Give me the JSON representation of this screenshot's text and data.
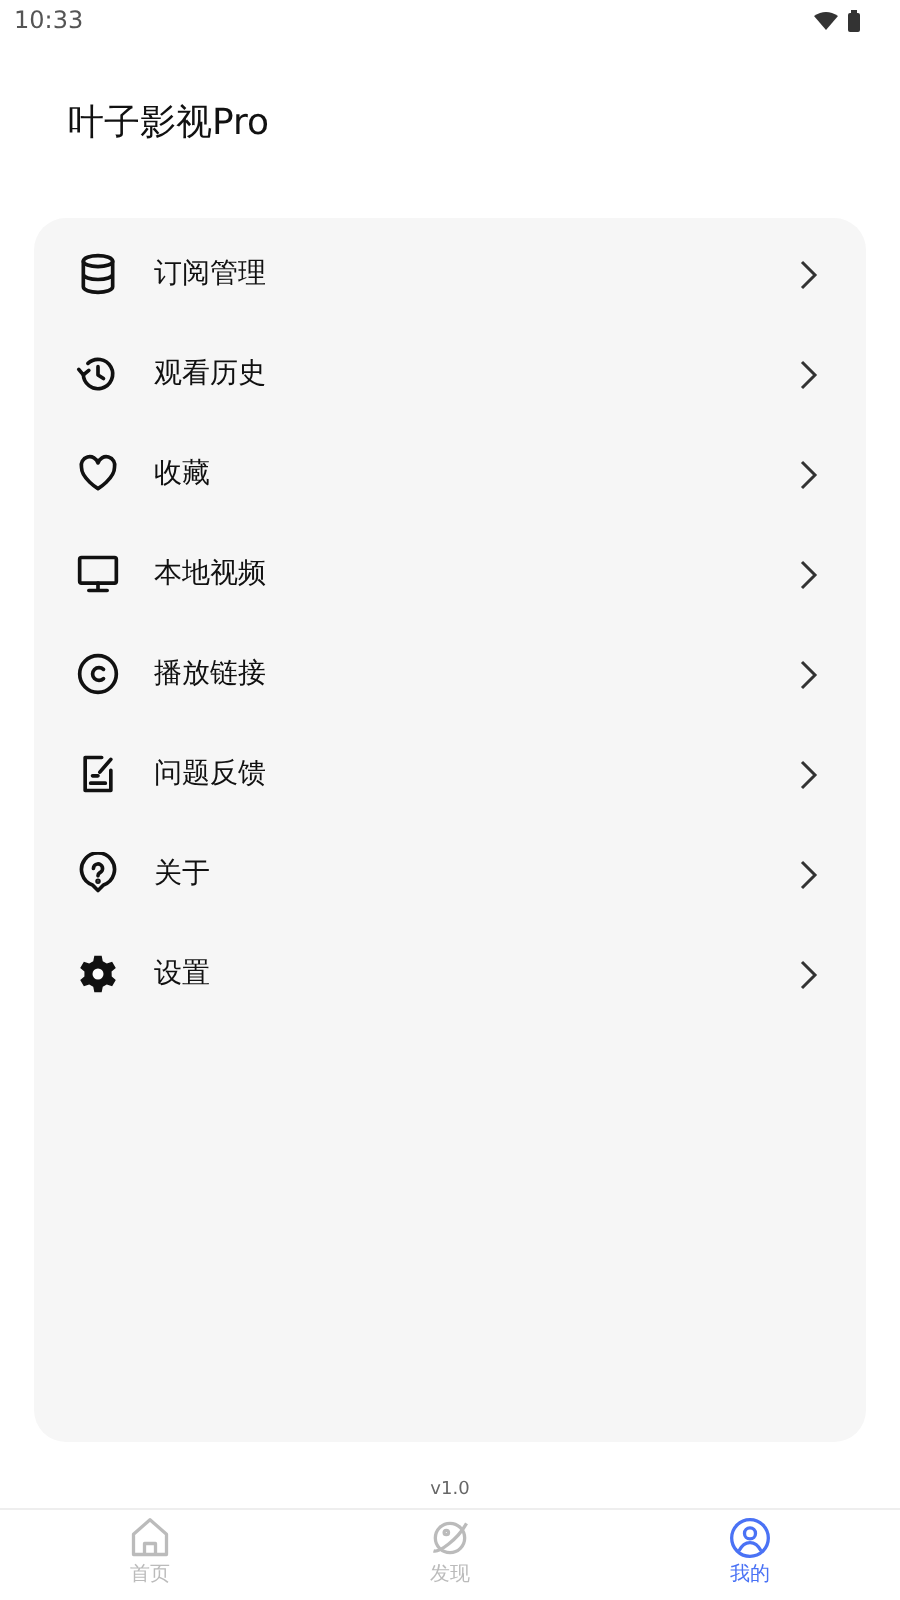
{
  "status_bar": {
    "time": "10:33"
  },
  "title": "叶子影视Pro",
  "menu": [
    {
      "label": "订阅管理"
    },
    {
      "label": "观看历史"
    },
    {
      "label": "收藏"
    },
    {
      "label": "本地视频"
    },
    {
      "label": "播放链接"
    },
    {
      "label": "问题反馈"
    },
    {
      "label": "关于"
    },
    {
      "label": "设置"
    }
  ],
  "version": "v1.0",
  "tabs": [
    {
      "label": "首页",
      "selected": false
    },
    {
      "label": "发现",
      "selected": false
    },
    {
      "label": "我的",
      "selected": true
    }
  ]
}
